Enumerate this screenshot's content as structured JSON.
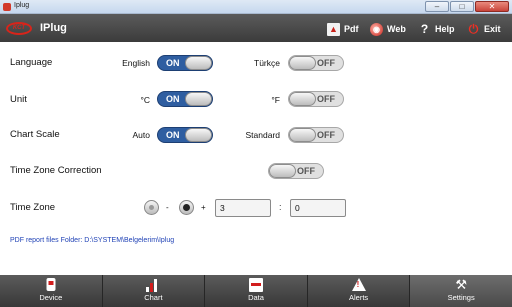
{
  "window": {
    "title": "Iplug",
    "controls": {
      "minimize": "–",
      "maximize": "□",
      "close": "✕"
    }
  },
  "header": {
    "logo_text": "KCT",
    "app_title": "IPlug",
    "buttons": [
      {
        "label": "Pdf",
        "icon": "pdf-icon",
        "glyph": "▲"
      },
      {
        "label": "Web",
        "icon": "globe-icon",
        "glyph": "◉"
      },
      {
        "label": "Help",
        "icon": "help-icon",
        "glyph": "?"
      },
      {
        "label": "Exit",
        "icon": "power-icon",
        "glyph": "⏻"
      }
    ]
  },
  "settings": {
    "language": {
      "label": "Language",
      "option_a": {
        "text": "English",
        "state": "ON"
      },
      "option_b": {
        "text": "Türkçe",
        "state": "OFF"
      }
    },
    "unit": {
      "label": "Unit",
      "option_a": {
        "text": "°C",
        "state": "ON"
      },
      "option_b": {
        "text": "°F",
        "state": "OFF"
      }
    },
    "chart_scale": {
      "label": "Chart Scale",
      "option_a": {
        "text": "Auto",
        "state": "ON"
      },
      "option_b": {
        "text": "Standard",
        "state": "OFF"
      }
    },
    "tz_correction": {
      "label": "Time Zone Correction",
      "state": "OFF"
    },
    "time_zone": {
      "label": "Time Zone",
      "minus_sign": "-",
      "plus_sign": "+",
      "selected": "plus",
      "hours": "3",
      "colon": ":",
      "minutes": "0"
    },
    "pdf_folder_note": "PDF report files Folder: D:\\SYSTEM\\Belgelerim\\Iplug"
  },
  "tabs": [
    {
      "label": "Device",
      "icon": "device-icon",
      "active": false
    },
    {
      "label": "Chart",
      "icon": "chart-icon",
      "active": false
    },
    {
      "label": "Data",
      "icon": "data-icon",
      "active": false
    },
    {
      "label": "Alerts",
      "icon": "alert-icon",
      "active": false
    },
    {
      "label": "Settings",
      "icon": "settings-icon",
      "active": true
    }
  ],
  "colors": {
    "toggle_on": "#2f5ea1",
    "header_bg": "#4a4a4a",
    "accent_red": "#d8241a",
    "link_blue": "#2143b6"
  }
}
